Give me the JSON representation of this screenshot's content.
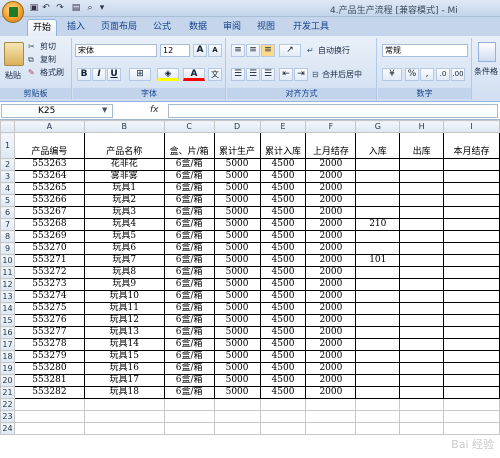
{
  "window": {
    "title": "4.产品生产流程 [兼容模式] - Mi"
  },
  "tabs": [
    "开始",
    "插入",
    "页面布局",
    "公式",
    "数据",
    "审阅",
    "视图",
    "开发工具"
  ],
  "ribbon": {
    "clipboard": {
      "paste": "粘贴",
      "cut": "剪切",
      "copy": "复制",
      "format_painter": "格式刷",
      "label": "剪贴板"
    },
    "font": {
      "name": "宋体",
      "size": "12",
      "bold": "B",
      "italic": "I",
      "underline": "U",
      "grow": "A",
      "shrink": "A",
      "font_color": "A",
      "label": "字体"
    },
    "alignment": {
      "wrap": "自动换行",
      "merge": "合并后居中",
      "label": "对齐方式"
    },
    "number": {
      "format": "常规",
      "percent": "%",
      "comma": ",",
      "label": "数字"
    },
    "styles": {
      "conditional": "条件格"
    }
  },
  "formula_bar": {
    "name_box": "K25",
    "fx": "fx",
    "value": ""
  },
  "columns": [
    "A",
    "B",
    "C",
    "D",
    "E",
    "F",
    "G",
    "H",
    "I"
  ],
  "header_row": [
    "产品编号",
    "产品名称",
    "盒、片/箱",
    "累计生产",
    "累计入库",
    "上月结存",
    "入库",
    "出库",
    "本月结存"
  ],
  "rows": [
    [
      "553263",
      "花非花",
      "6盒/箱",
      "5000",
      "4500",
      "2000",
      "",
      "",
      ""
    ],
    [
      "553264",
      "雾非雾",
      "6盒/箱",
      "5000",
      "4500",
      "2000",
      "",
      "",
      ""
    ],
    [
      "553265",
      "玩具1",
      "6盒/箱",
      "5000",
      "4500",
      "2000",
      "",
      "",
      ""
    ],
    [
      "553266",
      "玩具2",
      "6盒/箱",
      "5000",
      "4500",
      "2000",
      "",
      "",
      ""
    ],
    [
      "553267",
      "玩具3",
      "6盒/箱",
      "5000",
      "4500",
      "2000",
      "",
      "",
      ""
    ],
    [
      "553268",
      "玩具4",
      "6盒/箱",
      "5000",
      "4500",
      "2000",
      "210",
      "",
      ""
    ],
    [
      "553269",
      "玩具5",
      "6盒/箱",
      "5000",
      "4500",
      "2000",
      "",
      "",
      ""
    ],
    [
      "553270",
      "玩具6",
      "6盒/箱",
      "5000",
      "4500",
      "2000",
      "",
      "",
      ""
    ],
    [
      "553271",
      "玩具7",
      "6盒/箱",
      "5000",
      "4500",
      "2000",
      "101",
      "",
      ""
    ],
    [
      "553272",
      "玩具8",
      "6盒/箱",
      "5000",
      "4500",
      "2000",
      "",
      "",
      ""
    ],
    [
      "553273",
      "玩具9",
      "6盒/箱",
      "5000",
      "4500",
      "2000",
      "",
      "",
      ""
    ],
    [
      "553274",
      "玩具10",
      "6盒/箱",
      "5000",
      "4500",
      "2000",
      "",
      "",
      ""
    ],
    [
      "553275",
      "玩具11",
      "6盒/箱",
      "5000",
      "4500",
      "2000",
      "",
      "",
      ""
    ],
    [
      "553276",
      "玩具12",
      "6盒/箱",
      "5000",
      "4500",
      "2000",
      "",
      "",
      ""
    ],
    [
      "553277",
      "玩具13",
      "6盒/箱",
      "5000",
      "4500",
      "2000",
      "",
      "",
      ""
    ],
    [
      "553278",
      "玩具14",
      "6盒/箱",
      "5000",
      "4500",
      "2000",
      "",
      "",
      ""
    ],
    [
      "553279",
      "玩具15",
      "6盒/箱",
      "5000",
      "4500",
      "2000",
      "",
      "",
      ""
    ],
    [
      "553280",
      "玩具16",
      "6盒/箱",
      "5000",
      "4500",
      "2000",
      "",
      "",
      ""
    ],
    [
      "553281",
      "玩具17",
      "6盒/箱",
      "5000",
      "4500",
      "2000",
      "",
      "",
      ""
    ],
    [
      "553282",
      "玩具18",
      "6盒/箱",
      "5000",
      "4500",
      "2000",
      "",
      "",
      ""
    ]
  ],
  "row_numbers": [
    "1",
    "2",
    "3",
    "4",
    "5",
    "6",
    "7",
    "8",
    "9",
    "10",
    "11",
    "12",
    "13",
    "14",
    "15",
    "16",
    "17",
    "18",
    "19",
    "20",
    "21",
    "22",
    "23",
    "24"
  ],
  "watermark": "Bai 经验"
}
